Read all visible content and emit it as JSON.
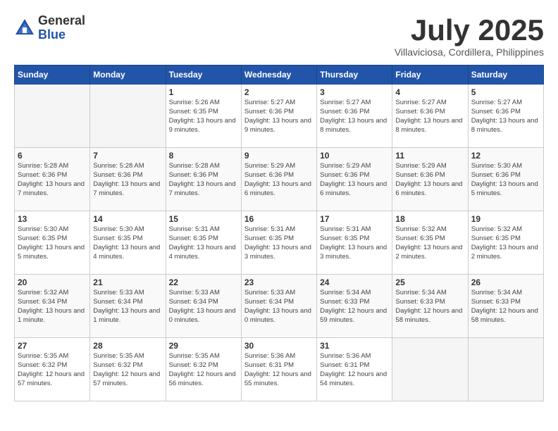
{
  "logo": {
    "general": "General",
    "blue": "Blue"
  },
  "title": "July 2025",
  "subtitle": "Villaviciosa, Cordillera, Philippines",
  "days_of_week": [
    "Sunday",
    "Monday",
    "Tuesday",
    "Wednesday",
    "Thursday",
    "Friday",
    "Saturday"
  ],
  "weeks": [
    [
      {
        "day": "",
        "info": ""
      },
      {
        "day": "",
        "info": ""
      },
      {
        "day": "1",
        "info": "Sunrise: 5:26 AM\nSunset: 6:35 PM\nDaylight: 13 hours and 9 minutes."
      },
      {
        "day": "2",
        "info": "Sunrise: 5:27 AM\nSunset: 6:36 PM\nDaylight: 13 hours and 9 minutes."
      },
      {
        "day": "3",
        "info": "Sunrise: 5:27 AM\nSunset: 6:36 PM\nDaylight: 13 hours and 8 minutes."
      },
      {
        "day": "4",
        "info": "Sunrise: 5:27 AM\nSunset: 6:36 PM\nDaylight: 13 hours and 8 minutes."
      },
      {
        "day": "5",
        "info": "Sunrise: 5:27 AM\nSunset: 6:36 PM\nDaylight: 13 hours and 8 minutes."
      }
    ],
    [
      {
        "day": "6",
        "info": "Sunrise: 5:28 AM\nSunset: 6:36 PM\nDaylight: 13 hours and 7 minutes."
      },
      {
        "day": "7",
        "info": "Sunrise: 5:28 AM\nSunset: 6:36 PM\nDaylight: 13 hours and 7 minutes."
      },
      {
        "day": "8",
        "info": "Sunrise: 5:28 AM\nSunset: 6:36 PM\nDaylight: 13 hours and 7 minutes."
      },
      {
        "day": "9",
        "info": "Sunrise: 5:29 AM\nSunset: 6:36 PM\nDaylight: 13 hours and 6 minutes."
      },
      {
        "day": "10",
        "info": "Sunrise: 5:29 AM\nSunset: 6:36 PM\nDaylight: 13 hours and 6 minutes."
      },
      {
        "day": "11",
        "info": "Sunrise: 5:29 AM\nSunset: 6:36 PM\nDaylight: 13 hours and 6 minutes."
      },
      {
        "day": "12",
        "info": "Sunrise: 5:30 AM\nSunset: 6:36 PM\nDaylight: 13 hours and 5 minutes."
      }
    ],
    [
      {
        "day": "13",
        "info": "Sunrise: 5:30 AM\nSunset: 6:35 PM\nDaylight: 13 hours and 5 minutes."
      },
      {
        "day": "14",
        "info": "Sunrise: 5:30 AM\nSunset: 6:35 PM\nDaylight: 13 hours and 4 minutes."
      },
      {
        "day": "15",
        "info": "Sunrise: 5:31 AM\nSunset: 6:35 PM\nDaylight: 13 hours and 4 minutes."
      },
      {
        "day": "16",
        "info": "Sunrise: 5:31 AM\nSunset: 6:35 PM\nDaylight: 13 hours and 3 minutes."
      },
      {
        "day": "17",
        "info": "Sunrise: 5:31 AM\nSunset: 6:35 PM\nDaylight: 13 hours and 3 minutes."
      },
      {
        "day": "18",
        "info": "Sunrise: 5:32 AM\nSunset: 6:35 PM\nDaylight: 13 hours and 2 minutes."
      },
      {
        "day": "19",
        "info": "Sunrise: 5:32 AM\nSunset: 6:35 PM\nDaylight: 13 hours and 2 minutes."
      }
    ],
    [
      {
        "day": "20",
        "info": "Sunrise: 5:32 AM\nSunset: 6:34 PM\nDaylight: 13 hours and 1 minute."
      },
      {
        "day": "21",
        "info": "Sunrise: 5:33 AM\nSunset: 6:34 PM\nDaylight: 13 hours and 1 minute."
      },
      {
        "day": "22",
        "info": "Sunrise: 5:33 AM\nSunset: 6:34 PM\nDaylight: 13 hours and 0 minutes."
      },
      {
        "day": "23",
        "info": "Sunrise: 5:33 AM\nSunset: 6:34 PM\nDaylight: 13 hours and 0 minutes."
      },
      {
        "day": "24",
        "info": "Sunrise: 5:34 AM\nSunset: 6:33 PM\nDaylight: 12 hours and 59 minutes."
      },
      {
        "day": "25",
        "info": "Sunrise: 5:34 AM\nSunset: 6:33 PM\nDaylight: 12 hours and 58 minutes."
      },
      {
        "day": "26",
        "info": "Sunrise: 5:34 AM\nSunset: 6:33 PM\nDaylight: 12 hours and 58 minutes."
      }
    ],
    [
      {
        "day": "27",
        "info": "Sunrise: 5:35 AM\nSunset: 6:32 PM\nDaylight: 12 hours and 57 minutes."
      },
      {
        "day": "28",
        "info": "Sunrise: 5:35 AM\nSunset: 6:32 PM\nDaylight: 12 hours and 57 minutes."
      },
      {
        "day": "29",
        "info": "Sunrise: 5:35 AM\nSunset: 6:32 PM\nDaylight: 12 hours and 56 minutes."
      },
      {
        "day": "30",
        "info": "Sunrise: 5:36 AM\nSunset: 6:31 PM\nDaylight: 12 hours and 55 minutes."
      },
      {
        "day": "31",
        "info": "Sunrise: 5:36 AM\nSunset: 6:31 PM\nDaylight: 12 hours and 54 minutes."
      },
      {
        "day": "",
        "info": ""
      },
      {
        "day": "",
        "info": ""
      }
    ]
  ]
}
